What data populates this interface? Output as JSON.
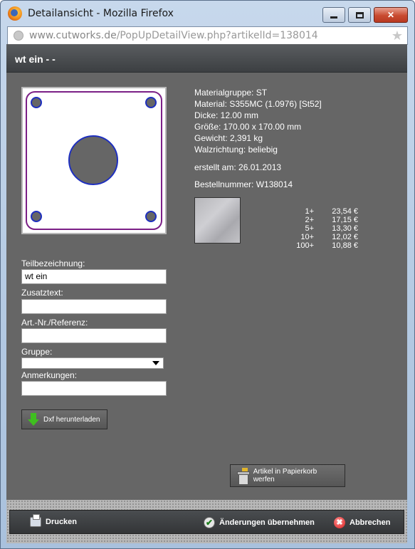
{
  "window": {
    "title": "Detailansicht - Mozilla Firefox",
    "minimize_glyph": "",
    "maximize_glyph": "",
    "close_glyph": "✕"
  },
  "urlbar": {
    "domain": "www.cutworks.de",
    "path": "/PopUpDetailView.php?artikelId=138014",
    "star_glyph": "★"
  },
  "page": {
    "title": "wt ein - -"
  },
  "form": {
    "teil_label": "Teilbezeichnung:",
    "teil_value": "wt ein",
    "zusatz_label": "Zusatztext:",
    "zusatz_value": "",
    "artnr_label": "Art.-Nr./Referenz:",
    "artnr_value": "",
    "gruppe_label": "Gruppe:",
    "gruppe_value": "",
    "anmerkungen_label": "Anmerkungen:",
    "anmerkungen_value": ""
  },
  "buttons": {
    "dxf_download": "Dxf herunterladen",
    "trash": "Artikel in Papierkorb werfen"
  },
  "details": {
    "materialgruppe": "Materialgruppe: ST",
    "material": "Material: S355MC (1.0976) [St52]",
    "dicke": "Dicke: 12.00 mm",
    "groesse": "Größe: 170.00 x 170.00 mm",
    "gewicht": "Gewicht: 2,391 kg",
    "walzrichtung": "Walzrichtung: beliebig",
    "erstellt": "erstellt am: 26.01.2013",
    "bestellnummer": "Bestellnummer: W138014"
  },
  "prices": [
    {
      "qty": "1+",
      "amount": "23,54 €"
    },
    {
      "qty": "2+",
      "amount": "17,15 €"
    },
    {
      "qty": "5+",
      "amount": "13,30 €"
    },
    {
      "qty": "10+",
      "amount": "12,02 €"
    },
    {
      "qty": "100+",
      "amount": "10,88 €"
    }
  ],
  "footer": {
    "print": "Drucken",
    "apply": "Änderungen übernehmen",
    "cancel": "Abbrechen",
    "check_glyph": "✔",
    "cancel_glyph": "✖"
  },
  "colors": {
    "content_bg": "#666666",
    "part_outline": "#7b1f86",
    "part_holes": "#1e2fbf",
    "titlebar": "#b3c9e2"
  }
}
